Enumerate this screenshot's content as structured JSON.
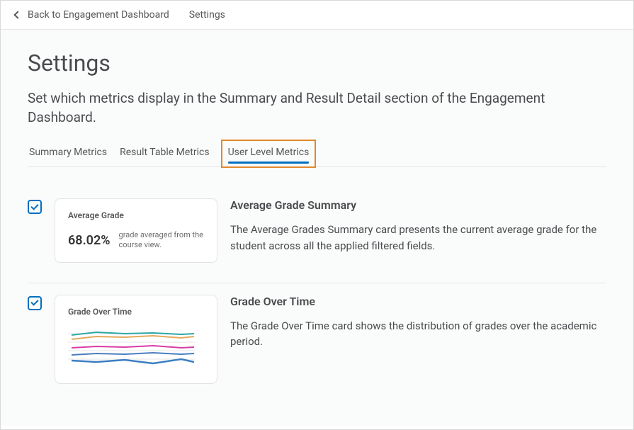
{
  "header": {
    "back_label": "Back to Engagement Dashboard",
    "breadcrumb_current": "Settings"
  },
  "page": {
    "title": "Settings",
    "description": "Set which metrics display in the Summary and Result Detail section of the Engagement Dashboard."
  },
  "tabs": {
    "items": [
      {
        "label": "Summary Metrics",
        "active": false
      },
      {
        "label": "Result Table Metrics",
        "active": false
      },
      {
        "label": "User Level Metrics",
        "active": true
      }
    ]
  },
  "settings": [
    {
      "checked": true,
      "preview_title": "Average Grade",
      "preview_value": "68.02%",
      "preview_desc": "grade averaged from the course view.",
      "title": "Average Grade Summary",
      "description": "The Average Grades Summary card presents the current average grade for the student across all the applied filtered fields."
    },
    {
      "checked": true,
      "preview_title": "Grade Over Time",
      "preview_value": "",
      "preview_desc": "",
      "title": "Grade Over Time",
      "description": "The Grade Over Time card shows the distribution of grades over the academic period."
    }
  ]
}
